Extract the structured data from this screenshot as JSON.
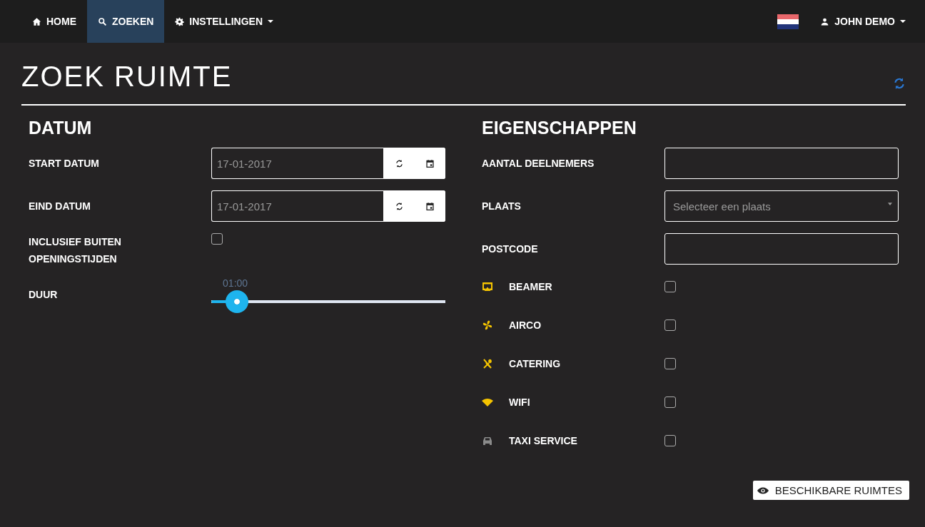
{
  "navbar": {
    "items": [
      {
        "kind": "home",
        "label": "HOME",
        "selected": false,
        "dropdown": false
      },
      {
        "kind": "search",
        "label": "ZOEKEN",
        "selected": true,
        "dropdown": false
      },
      {
        "kind": "settings",
        "label": "INSTELLINGEN",
        "selected": false,
        "dropdown": true
      }
    ],
    "user": {
      "label": "JOHN DEMO"
    }
  },
  "page_title": "ZOEK RUIMTE",
  "datum": {
    "heading": "DATUM",
    "start": {
      "label": "START DATUM",
      "value": "17-01-2017"
    },
    "end": {
      "label": "EIND DATUM",
      "value": "17-01-2017"
    },
    "outside_hours": {
      "label": "INCLUSIEF BUITEN OPENINGSTIJDEN",
      "checked": false
    },
    "duration": {
      "label": "DUUR",
      "reading": "01:00",
      "level": 0.11
    }
  },
  "eigenschappen": {
    "heading": "EIGENSCHAPPEN",
    "participants": {
      "label": "AANTAL DEELNEMERS"
    },
    "place": {
      "label": "PLAATS",
      "placeholder": "Selecteer een plaats"
    },
    "postcode": {
      "label": "POSTCODE"
    },
    "amenities": [
      {
        "kind": "beamer",
        "label": "BEAMER",
        "color": "#f5c400",
        "checked": false
      },
      {
        "kind": "airco",
        "label": "AIRCO",
        "color": "#f5c400",
        "checked": false
      },
      {
        "kind": "catering",
        "label": "CATERING",
        "color": "#f5c400",
        "checked": false
      },
      {
        "kind": "wifi",
        "label": "WIFI",
        "color": "#f5c400",
        "checked": false
      },
      {
        "kind": "taxi",
        "label": "TAXI SERVICE",
        "color": "#8a8a8a",
        "checked": false
      }
    ]
  },
  "submit": {
    "label": "BESCHIKBARE RUIMTES"
  }
}
